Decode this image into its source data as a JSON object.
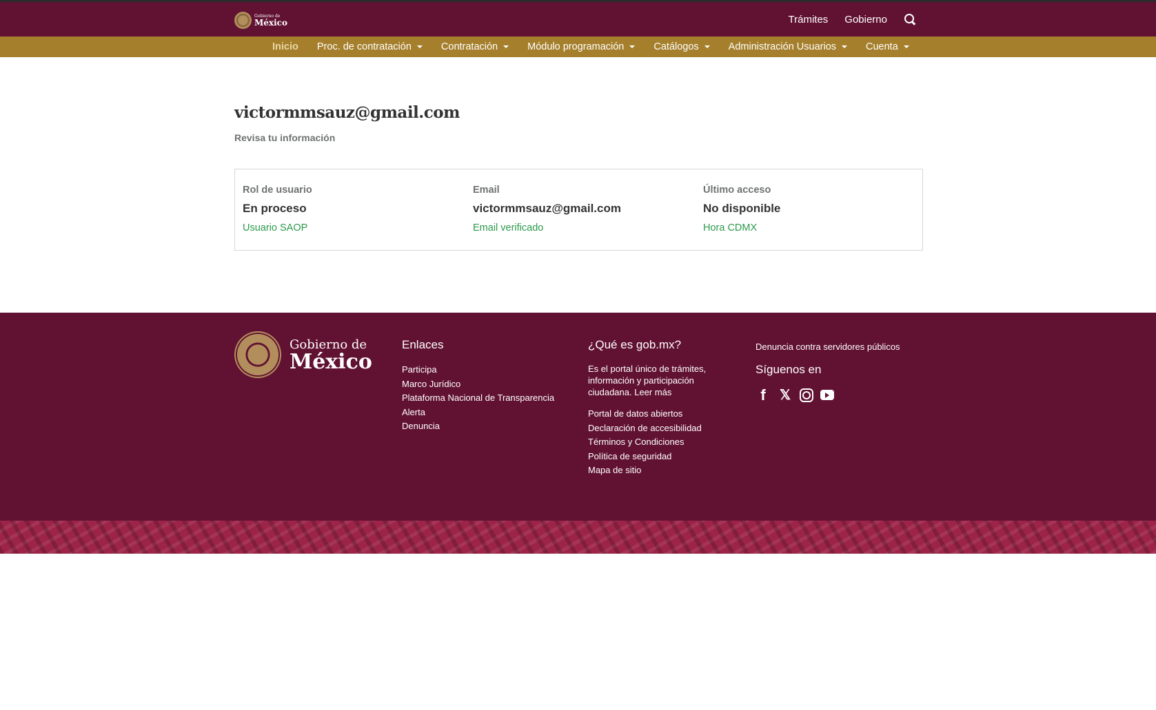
{
  "header": {
    "logo_small_line1": "Gobierno de",
    "logo_small_line2": "México",
    "links": [
      "Trámites",
      "Gobierno"
    ]
  },
  "mainnav": {
    "items": [
      {
        "label": "Inicio",
        "active": true,
        "dropdown": false
      },
      {
        "label": "Proc. de contratación",
        "dropdown": true
      },
      {
        "label": "Contratación",
        "dropdown": true
      },
      {
        "label": "Módulo programación",
        "dropdown": true
      },
      {
        "label": "Catálogos",
        "dropdown": true
      },
      {
        "label": "Administración Usuarios",
        "dropdown": true
      },
      {
        "label": "Cuenta",
        "dropdown": true
      }
    ]
  },
  "main": {
    "title": "victormmsauz@gmail.com",
    "subtitle": "Revisa tu información",
    "card": [
      {
        "label": "Rol de usuario",
        "value": "En proceso",
        "sub": "Usuario SAOP"
      },
      {
        "label": "Email",
        "value": "victormmsauz@gmail.com",
        "sub": "Email verificado"
      },
      {
        "label": "Último acceso",
        "value": "No disponible",
        "sub": "Hora CDMX"
      }
    ]
  },
  "footer": {
    "logo_line1": "Gobierno de",
    "logo_line2": "México",
    "enlaces": {
      "title": "Enlaces",
      "links": [
        "Participa",
        "Marco Jurídico",
        "Plataforma Nacional de Transparencia",
        "Alerta",
        "Denuncia"
      ]
    },
    "que_es": {
      "title": "¿Qué es gob.mx?",
      "text": "Es el portal único de trámites, información y participación ciudadana. Leer más",
      "links": [
        "Portal de datos abiertos",
        "Declaración de accesibilidad",
        "Términos y Condiciones",
        "Política de seguridad",
        "Mapa de sitio"
      ]
    },
    "denuncia": "Denuncia contra servidores públicos",
    "siguenos": "Síguenos en",
    "social_icons": [
      "facebook-icon",
      "x-icon",
      "instagram-icon",
      "youtube-icon"
    ]
  },
  "colors": {
    "primary": "#611232",
    "gold": "#a57f2c",
    "success": "#2a9a4a",
    "pattern": "#9d2449"
  }
}
